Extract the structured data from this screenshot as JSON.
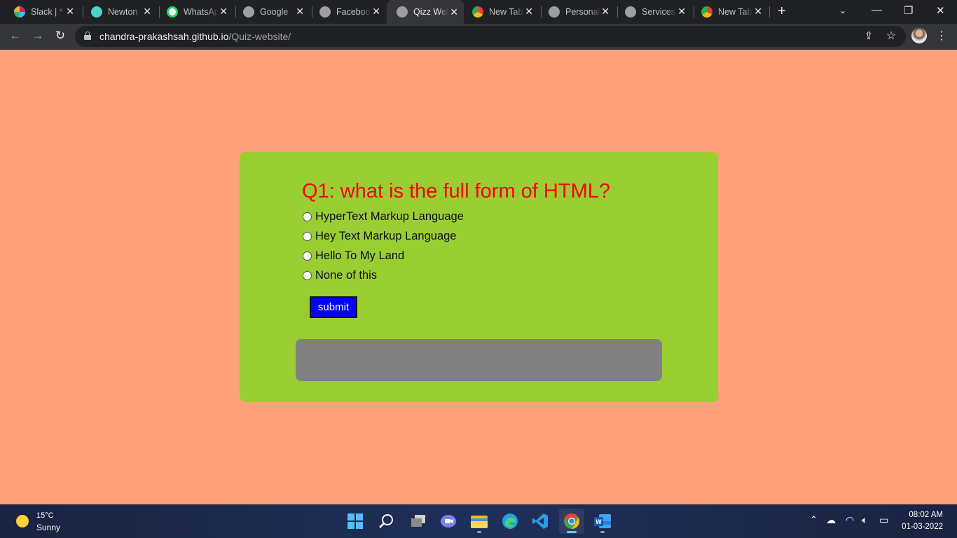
{
  "browser": {
    "tabs": [
      {
        "title": "Slack | *",
        "icon": "slack-icon"
      },
      {
        "title": "Newton",
        "icon": "newton-icon"
      },
      {
        "title": "WhatsApp",
        "icon": "whatsapp-icon"
      },
      {
        "title": "Google",
        "icon": "globe-icon"
      },
      {
        "title": "Facebook",
        "icon": "globe-icon"
      },
      {
        "title": "Qizz Website",
        "icon": "globe-icon",
        "active": true
      },
      {
        "title": "New Tab",
        "icon": "chrome-icon"
      },
      {
        "title": "Personal",
        "icon": "globe-icon"
      },
      {
        "title": "Services",
        "icon": "globe-icon"
      },
      {
        "title": "New Tab",
        "icon": "chrome-icon"
      }
    ],
    "url_host": "chandra-prakashsah.github.io",
    "url_path": "/Quiz-website/"
  },
  "quiz": {
    "question": "Q1: what is the full form of HTML?",
    "options": [
      "HyperText Markup Language",
      "Hey Text Markup Language",
      "Hello To My Land",
      "None of this"
    ],
    "submit_label": "submit",
    "result_text": ""
  },
  "taskbar": {
    "weather_temp": "15°C",
    "weather_condition": "Sunny",
    "time": "08:02 AM",
    "date": "01-03-2022"
  },
  "colors": {
    "page_background": "#ffa07a",
    "card_background": "#9acd32",
    "question_color": "#ff0000",
    "submit_background": "#0000ff",
    "result_box": "#808080"
  }
}
